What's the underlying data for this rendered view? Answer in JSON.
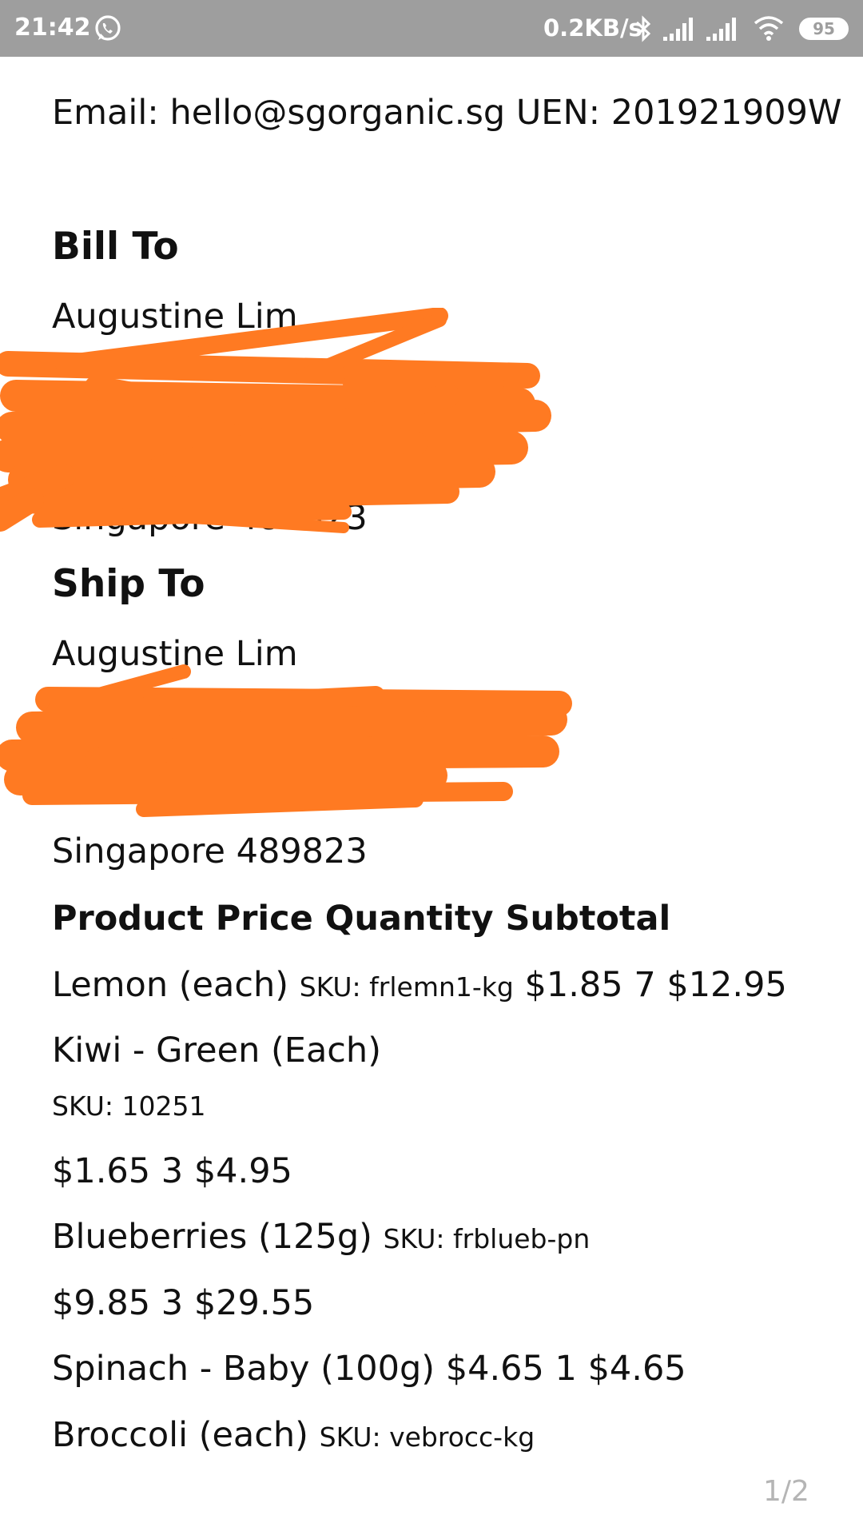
{
  "status_bar": {
    "time": "21:42",
    "network_speed": "0.2KB/s",
    "battery": "95",
    "icons": [
      "whatsapp-icon",
      "bluetooth-icon",
      "signal-icon",
      "signal-icon",
      "wifi-icon",
      "battery-icon"
    ]
  },
  "document": {
    "contact_line": "Email: hello@sgorganic.sg UEN: 201921909W",
    "bill_to": {
      "heading": "Bill To",
      "name": "Augustine Lim",
      "postal_line_partial": "Singapore 489823"
    },
    "ship_to": {
      "heading": "Ship To",
      "name": "Augustine Lim",
      "postal_line": "Singapore 489823"
    },
    "table": {
      "headers": [
        "Product",
        "Price",
        "Quantity",
        "Subtotal"
      ],
      "rows": [
        {
          "product": "Lemon (each)",
          "sku": "SKU: frlemn1-kg",
          "price": "$1.85",
          "quantity": "7",
          "subtotal": "$12.95"
        },
        {
          "product": "Kiwi - Green (Each)",
          "sku": "SKU: 10251",
          "price": "$1.65",
          "quantity": "3",
          "subtotal": "$4.95"
        },
        {
          "product": "Blueberries (125g)",
          "sku": "SKU: frblueb-pn",
          "price": "$9.85",
          "quantity": "3",
          "subtotal": "$29.55"
        },
        {
          "product": "Spinach - Baby (100g)",
          "sku": "",
          "price": "$4.65",
          "quantity": "1",
          "subtotal": "$4.65"
        },
        {
          "product": "Broccoli (each)",
          "sku": "SKU: vebrocc-kg"
        }
      ]
    }
  },
  "redaction_color": "#ff7a22",
  "page_indicator": "1/2"
}
